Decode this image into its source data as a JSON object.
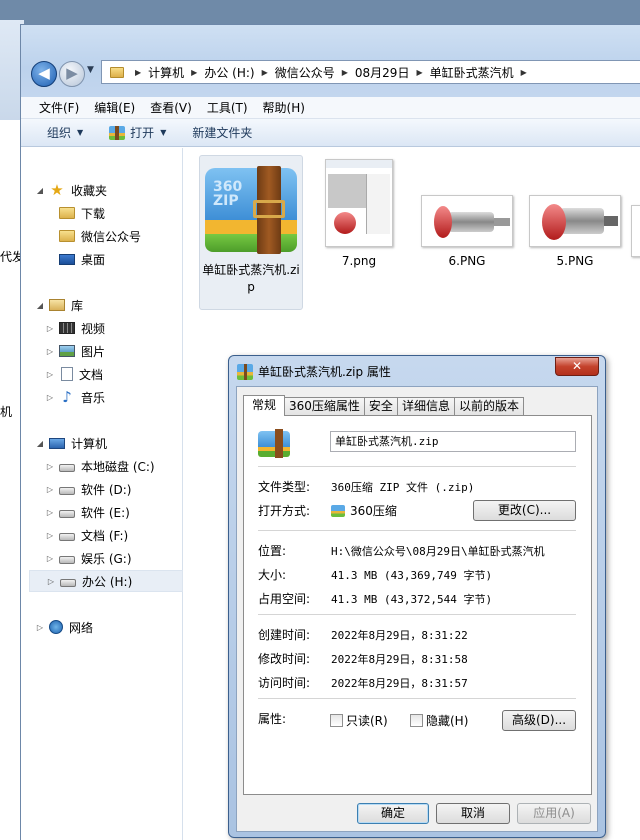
{
  "background_window": {
    "partial_text_1": "代发",
    "partial_text_2": "机"
  },
  "address": {
    "crumbs": [
      "计算机",
      "办公 (H:)",
      "微信公众号",
      "08月29日",
      "单缸卧式蒸汽机"
    ]
  },
  "menu": [
    "文件(F)",
    "编辑(E)",
    "查看(V)",
    "工具(T)",
    "帮助(H)"
  ],
  "toolbar": {
    "organize": "组织",
    "open": "打开",
    "new_folder": "新建文件夹"
  },
  "nav": {
    "favorites": "收藏夹",
    "downloads": "下载",
    "wechat": "微信公众号",
    "desktop": "桌面",
    "libraries": "库",
    "videos": "视频",
    "pictures": "图片",
    "documents": "文档",
    "music": "音乐",
    "computer": "计算机",
    "drive_c": "本地磁盘 (C:)",
    "drive_d": "软件 (D:)",
    "drive_e": "软件 (E:)",
    "drive_f": "文档 (F:)",
    "drive_g": "娱乐 (G:)",
    "drive_h": "办公 (H:)",
    "network": "网络"
  },
  "files": [
    {
      "name": "单缸卧式蒸汽机.zip",
      "icon": "360zip-icon",
      "icon_text": "360 ZIP"
    },
    {
      "name": "7.png"
    },
    {
      "name": "6.PNG"
    },
    {
      "name": "5.PNG"
    }
  ],
  "dialog": {
    "title": "单缸卧式蒸汽机.zip 属性",
    "close": "✕",
    "tabs": [
      "常规",
      "360压缩属性",
      "安全",
      "详细信息",
      "以前的版本"
    ],
    "file_name": "单缸卧式蒸汽机.zip",
    "type_label": "文件类型:",
    "type_value": "360压缩 ZIP 文件 (.zip)",
    "open_with_label": "打开方式:",
    "open_with_value": "360压缩",
    "change_button": "更改(C)...",
    "location_label": "位置:",
    "location_value": "H:\\微信公众号\\08月29日\\单缸卧式蒸汽机",
    "size_label": "大小:",
    "size_value": "41.3 MB (43,369,749 字节)",
    "size_on_disk_label": "占用空间:",
    "size_on_disk_value": "41.3 MB (43,372,544 字节)",
    "created_label": "创建时间:",
    "created_value": "2022年8月29日，8:31:22",
    "modified_label": "修改时间:",
    "modified_value": "2022年8月29日，8:31:58",
    "accessed_label": "访问时间:",
    "accessed_value": "2022年8月29日，8:31:57",
    "attributes_label": "属性:",
    "readonly_label": "只读(R)",
    "hidden_label": "隐藏(H)",
    "advanced_button": "高级(D)...",
    "ok_button": "确定",
    "cancel_button": "取消",
    "apply_button": "应用(A)"
  }
}
